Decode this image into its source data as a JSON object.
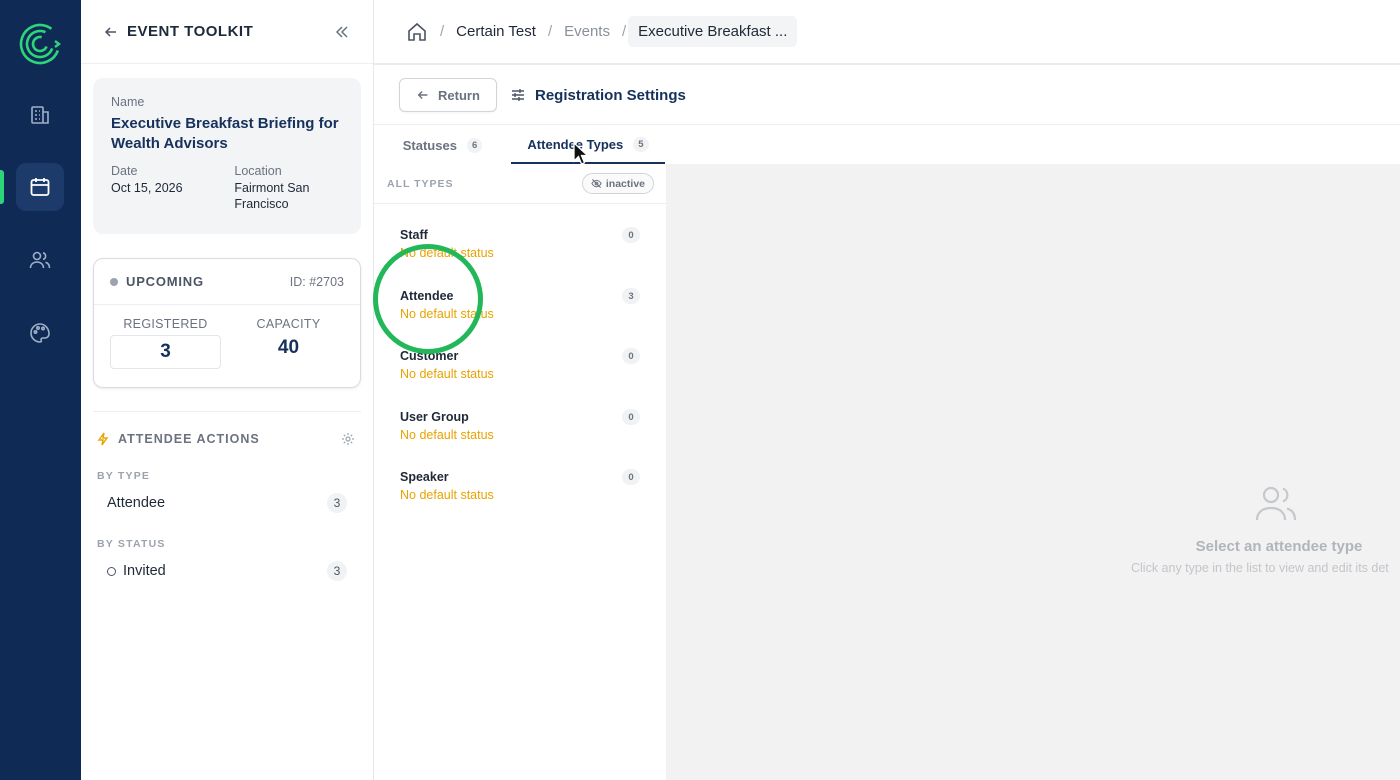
{
  "rail": {
    "items": [
      "building-icon",
      "calendar-icon",
      "users-icon",
      "palette-icon"
    ],
    "active": "calendar-icon",
    "colors": {
      "bg": "#0e2a55",
      "accent": "#2ed47a"
    }
  },
  "toolkit": {
    "title": "EVENT TOOLKIT",
    "info": {
      "name_label": "Name",
      "name": "Executive Breakfast Briefing for Wealth Advisors",
      "date_label": "Date",
      "date": "Oct 15, 2026",
      "location_label": "Location",
      "location": "Fairmont San Francisco"
    },
    "status": {
      "label": "UPCOMING",
      "id": "ID: #2703",
      "registered_label": "REGISTERED",
      "registered": "3",
      "capacity_label": "CAPACITY",
      "capacity": "40"
    },
    "actions": {
      "title": "ATTENDEE ACTIONS",
      "by_type_label": "BY TYPE",
      "by_type": [
        {
          "label": "Attendee",
          "count": "3"
        }
      ],
      "by_status_label": "BY STATUS",
      "by_status": [
        {
          "label": "Invited",
          "count": "3"
        }
      ]
    }
  },
  "breadcrumb": {
    "items": [
      "Certain Test",
      "Events",
      "Executive Breakfast ..."
    ]
  },
  "subbar": {
    "return_label": "Return",
    "title": "Registration Settings"
  },
  "tabs": [
    {
      "label": "Statuses",
      "badge": "6"
    },
    {
      "label": "Attendee Types",
      "badge": "5",
      "active": true
    }
  ],
  "type_list": {
    "header": "ALL TYPES",
    "inactive_label": "inactive",
    "items": [
      {
        "name": "Staff",
        "status": "No default status",
        "count": "0"
      },
      {
        "name": "Attendee",
        "status": "No default status",
        "count": "3"
      },
      {
        "name": "Customer",
        "status": "No default status",
        "count": "0"
      },
      {
        "name": "User Group",
        "status": "No default status",
        "count": "0"
      },
      {
        "name": "Speaker",
        "status": "No default status",
        "count": "0"
      }
    ]
  },
  "detail": {
    "empty_title": "Select an attendee type",
    "empty_sub": "Click any type in the list to view and edit its det"
  }
}
